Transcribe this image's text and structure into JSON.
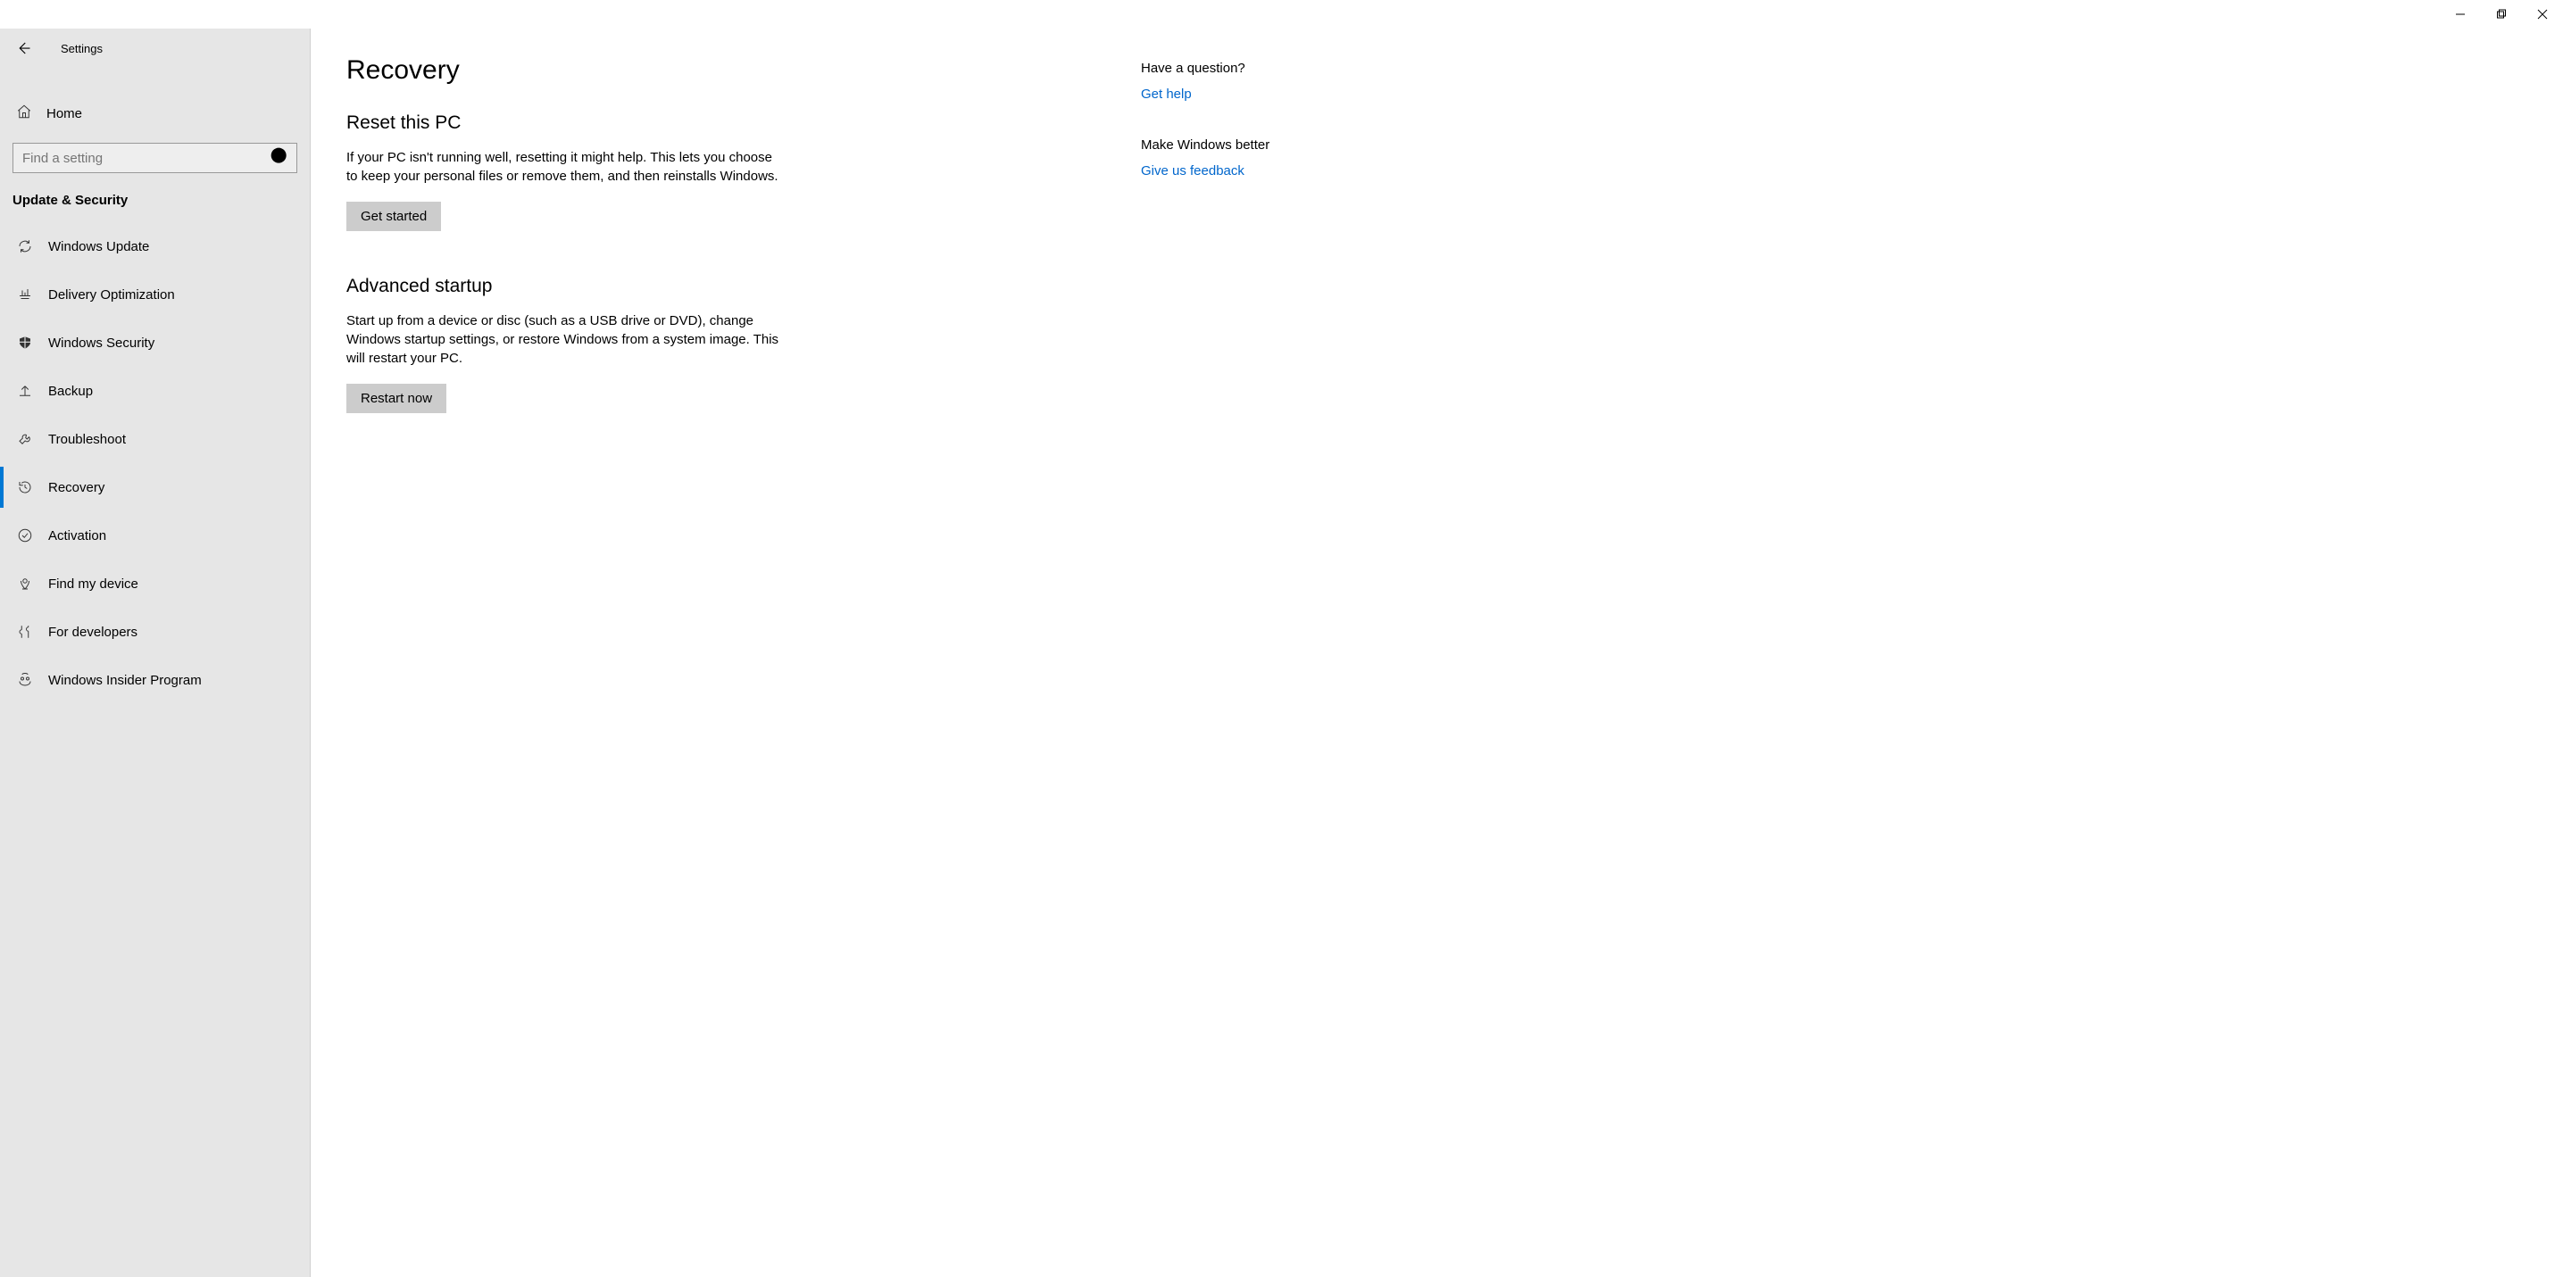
{
  "window": {
    "title": "Settings"
  },
  "sidebar": {
    "home": "Home",
    "search_placeholder": "Find a setting",
    "section": "Update & Security",
    "items": [
      {
        "label": "Windows Update"
      },
      {
        "label": "Delivery Optimization"
      },
      {
        "label": "Windows Security"
      },
      {
        "label": "Backup"
      },
      {
        "label": "Troubleshoot"
      },
      {
        "label": "Recovery"
      },
      {
        "label": "Activation"
      },
      {
        "label": "Find my device"
      },
      {
        "label": "For developers"
      },
      {
        "label": "Windows Insider Program"
      }
    ]
  },
  "main": {
    "title": "Recovery",
    "sections": [
      {
        "heading": "Reset this PC",
        "desc": "If your PC isn't running well, resetting it might help. This lets you choose to keep your personal files or remove them, and then reinstalls Windows.",
        "button": "Get started"
      },
      {
        "heading": "Advanced startup",
        "desc": "Start up from a device or disc (such as a USB drive or DVD), change Windows startup settings, or restore Windows from a system image. This will restart your PC.",
        "button": "Restart now"
      }
    ]
  },
  "aside": {
    "q_head": "Have a question?",
    "q_link": "Get help",
    "f_head": "Make Windows better",
    "f_link": "Give us feedback"
  }
}
